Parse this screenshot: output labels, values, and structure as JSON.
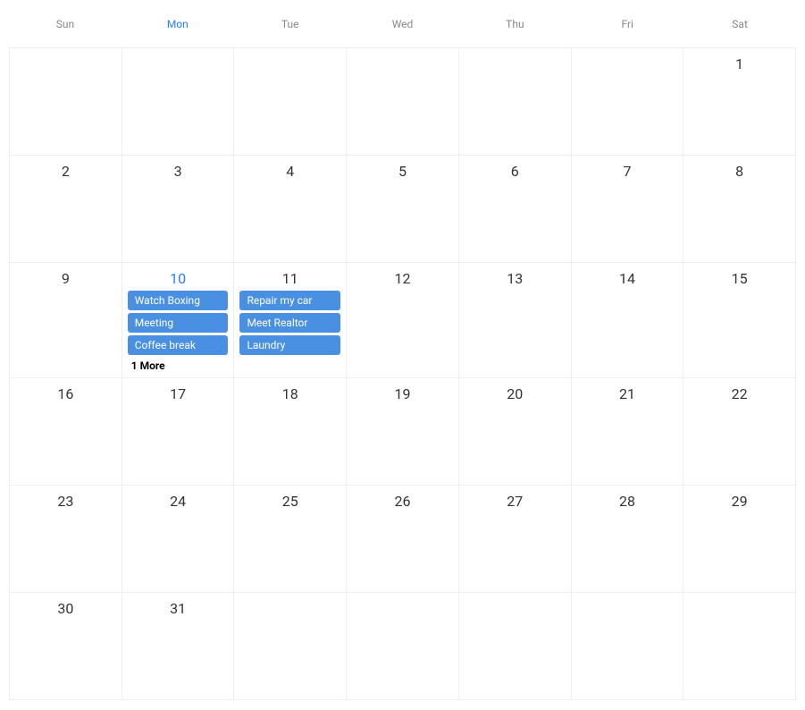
{
  "colors": {
    "event_bg": "#4a90e2",
    "active": "#2a7fff",
    "muted": "#888",
    "border": "#eee"
  },
  "header": {
    "days": [
      "Sun",
      "Mon",
      "Tue",
      "Wed",
      "Thu",
      "Fri",
      "Sat"
    ],
    "active_index": 1
  },
  "today": 10,
  "weeks": [
    {
      "days": [
        {
          "num": ""
        },
        {
          "num": ""
        },
        {
          "num": ""
        },
        {
          "num": ""
        },
        {
          "num": ""
        },
        {
          "num": ""
        },
        {
          "num": "1"
        }
      ]
    },
    {
      "days": [
        {
          "num": "2"
        },
        {
          "num": "3"
        },
        {
          "num": "4"
        },
        {
          "num": "5"
        },
        {
          "num": "6"
        },
        {
          "num": "7"
        },
        {
          "num": "8"
        }
      ]
    },
    {
      "days": [
        {
          "num": "9"
        },
        {
          "num": "10",
          "today": true,
          "events": [
            "Watch Boxing",
            "Meeting",
            "Coffee break"
          ],
          "more": "1 More"
        },
        {
          "num": "11",
          "events": [
            "Repair my car",
            "Meet Realtor",
            "Laundry"
          ]
        },
        {
          "num": "12"
        },
        {
          "num": "13"
        },
        {
          "num": "14"
        },
        {
          "num": "15"
        }
      ]
    },
    {
      "days": [
        {
          "num": "16"
        },
        {
          "num": "17"
        },
        {
          "num": "18"
        },
        {
          "num": "19"
        },
        {
          "num": "20"
        },
        {
          "num": "21"
        },
        {
          "num": "22"
        }
      ]
    },
    {
      "days": [
        {
          "num": "23"
        },
        {
          "num": "24"
        },
        {
          "num": "25"
        },
        {
          "num": "26"
        },
        {
          "num": "27"
        },
        {
          "num": "28"
        },
        {
          "num": "29"
        }
      ]
    },
    {
      "days": [
        {
          "num": "30"
        },
        {
          "num": "31"
        },
        {
          "num": ""
        },
        {
          "num": ""
        },
        {
          "num": ""
        },
        {
          "num": ""
        },
        {
          "num": ""
        }
      ]
    }
  ]
}
